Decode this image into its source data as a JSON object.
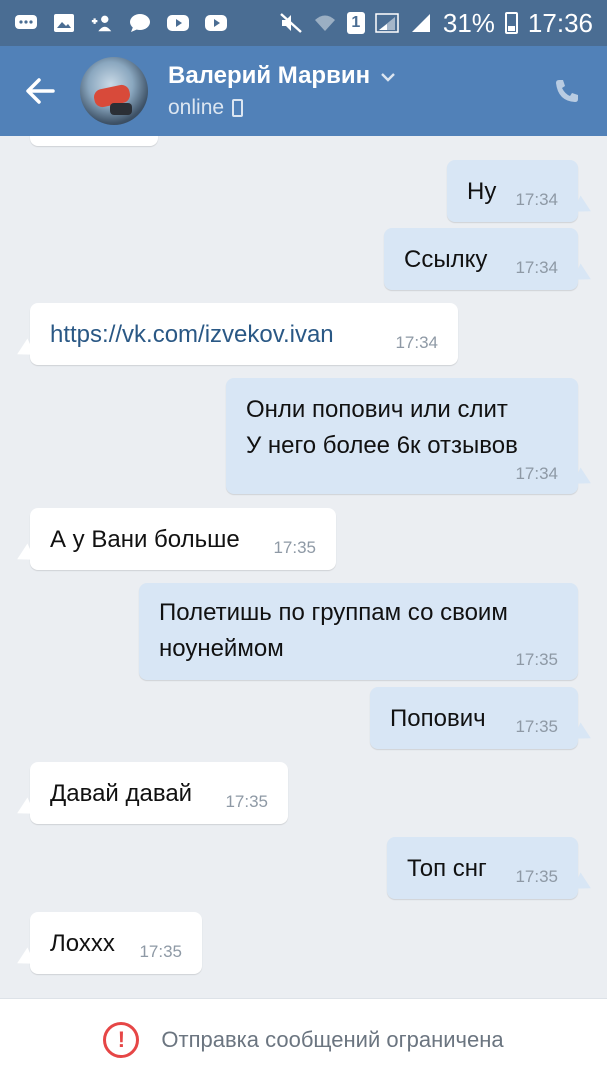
{
  "status_bar": {
    "left_icons": [
      "chat-bubbles-icon",
      "gallery-icon",
      "add-contact-icon",
      "message-icon",
      "youtube-icon",
      "youtube-icon"
    ],
    "sim": "1",
    "battery": "31%",
    "time": "17:36"
  },
  "header": {
    "name": "Валерий Марвин",
    "status": "online"
  },
  "messages": [
    {
      "dir": "out",
      "text": "Ну",
      "time": "17:34"
    },
    {
      "dir": "out",
      "text": "Ссылку",
      "time": "17:34"
    },
    {
      "dir": "in",
      "text": "https://vk.com/izvekov.ivan",
      "time": "17:34",
      "is_link": true
    },
    {
      "dir": "out",
      "text": "Онли попович или слит\nУ него более 6к отзывов",
      "time": "17:34"
    },
    {
      "dir": "in",
      "text": "А у Вани больше",
      "time": "17:35"
    },
    {
      "dir": "out",
      "text": "Полетишь по группам со своим\nноунеймом",
      "time": "17:35"
    },
    {
      "dir": "out",
      "text": "Попович",
      "time": "17:35"
    },
    {
      "dir": "in",
      "text": "Давай давай",
      "time": "17:35"
    },
    {
      "dir": "out",
      "text": "Топ снг",
      "time": "17:35"
    },
    {
      "dir": "in",
      "text": "Лохxx",
      "time": "17:35"
    }
  ],
  "footer": {
    "notice": "Отправка сообщений ограничена"
  },
  "colors": {
    "header_bg": "#5181b8",
    "status_bg": "#4a6d93",
    "bubble_out": "#d8e6f5",
    "bubble_in": "#ffffff",
    "chat_bg": "#ebeef2",
    "warning": "#e64646"
  }
}
